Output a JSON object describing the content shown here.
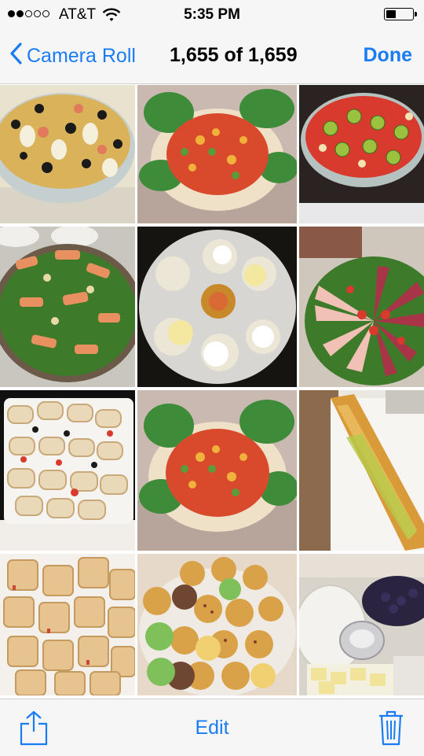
{
  "status_bar": {
    "carrier": "AT&T",
    "time": "5:35 PM",
    "signal_bars_filled": 2,
    "signal_bars_total": 5,
    "battery_level": 0.35
  },
  "nav": {
    "back_label": "Camera Roll",
    "title": "1,655 of 1,659",
    "done_label": "Done"
  },
  "toolbar": {
    "edit_label": "Edit",
    "share_icon": "share-icon",
    "trash_icon": "trash-icon"
  },
  "photos": [
    {
      "subject": "olive-egg-salad-bowl"
    },
    {
      "subject": "tomato-corn-salad-lettuce-platter"
    },
    {
      "subject": "fruit-tart-kiwi-strawberry"
    },
    {
      "subject": "smoked-salmon-green-salad"
    },
    {
      "subject": "cheese-ball-party-tray"
    },
    {
      "subject": "cold-cut-meat-platter"
    },
    {
      "subject": "tortilla-pinwheel-platter"
    },
    {
      "subject": "tomato-corn-salad-lettuce-platter"
    },
    {
      "subject": "long-sub-sandwich"
    },
    {
      "subject": "pastry-roll-tray"
    },
    {
      "subject": "muffin-cookie-tray"
    },
    {
      "subject": "fruit-and-cheese-tray"
    }
  ],
  "colors": {
    "accent": "#1a7cf5",
    "bar_background": "#f6f6f6"
  }
}
